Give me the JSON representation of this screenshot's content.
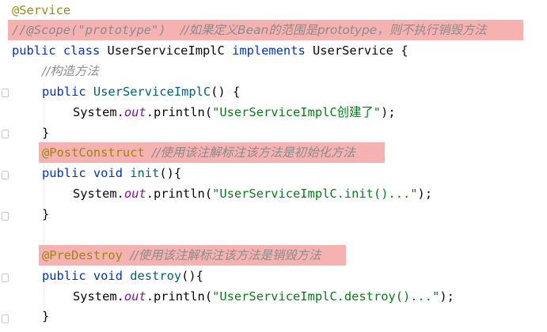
{
  "editor": {
    "line1": {
      "annotation": "@Service"
    },
    "line2": {
      "code": "//@Scope(\"prototype\")  ",
      "comment": "//如果定义Bean的范围是prototype，则不执行销毁方法"
    },
    "line3": {
      "kw_public": "public",
      "kw_class": "class",
      "class_name": "UserServiceImplC",
      "kw_implements": "implements",
      "iface": "UserService",
      "brace": "{"
    },
    "line4": {
      "comment": "//构造方法"
    },
    "line5": {
      "kw_public": "public",
      "ctor": "UserServiceImplC",
      "rest": "() {"
    },
    "line6": {
      "system": "System.",
      "out": "out",
      "println": ".println(",
      "str": "\"UserServiceImplC创建了\"",
      "end": ");"
    },
    "line7": {
      "brace": "}"
    },
    "line8": {
      "annotation": "@PostConstruct",
      "comment": "//使用该注解标注该方法是初始化方法"
    },
    "line9": {
      "kw_public": "public",
      "kw_void": "void",
      "method": "init",
      "rest": "(){"
    },
    "line10": {
      "system": "System.",
      "out": "out",
      "println": ".println(",
      "str": "\"UserServiceImplC.init()...\"",
      "end": ");"
    },
    "line11": {
      "brace": "}"
    },
    "line13": {
      "annotation": "@PreDestroy",
      "comment": "//使用该注解标注该方法是销毁方法"
    },
    "line14": {
      "kw_public": "public",
      "kw_void": "void",
      "method": "destroy",
      "rest": "(){"
    },
    "line15": {
      "system": "System.",
      "out": "out",
      "println": ".println(",
      "str": "\"UserServiceImplC.destroy()...\"",
      "end": ");"
    },
    "line16": {
      "brace": "}"
    }
  },
  "colors": {
    "background": "#ffffff",
    "highlight": "#f4a3a3",
    "annotation": "#9e880d",
    "keyword": "#0033b3",
    "comment": "#8c8c8c",
    "method": "#00627a",
    "string": "#067d17",
    "static_field": "#871094"
  }
}
